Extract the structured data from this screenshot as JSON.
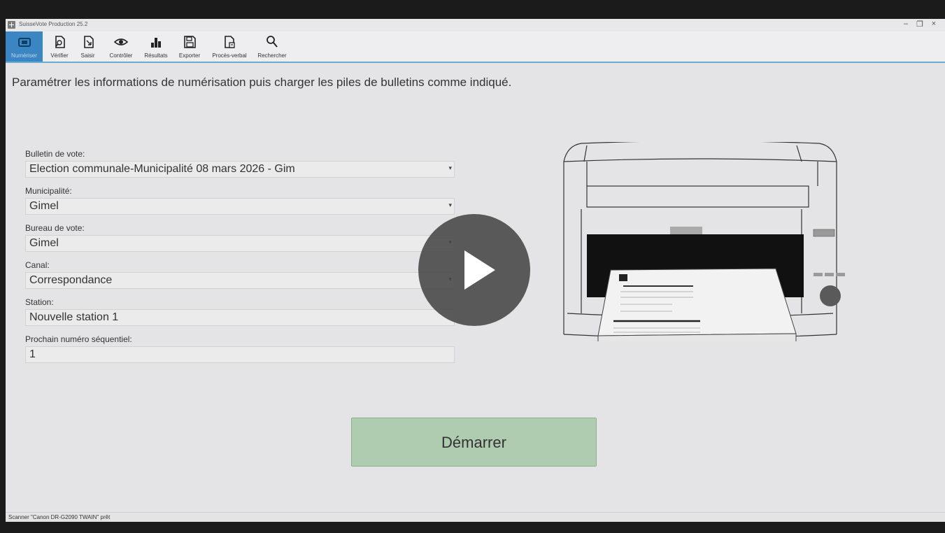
{
  "app": {
    "title": "SuisseVote Production 25.2"
  },
  "toolbar": {
    "items": [
      {
        "label": "Numériser",
        "icon": "scanner-icon",
        "active": true
      },
      {
        "label": "Vérifier",
        "icon": "verify-document-icon"
      },
      {
        "label": "Saisir",
        "icon": "input-document-icon"
      },
      {
        "label": "Contrôler",
        "icon": "eye-icon"
      },
      {
        "label": "Résultats",
        "icon": "bar-chart-icon"
      },
      {
        "label": "Exporter",
        "icon": "floppy-disk-icon"
      },
      {
        "label": "Procès-verbal",
        "icon": "report-document-icon"
      },
      {
        "label": "Rechercher",
        "icon": "search-icon"
      }
    ]
  },
  "main": {
    "instruction": "Paramétrer les informations de numérisation puis charger les piles de bulletins comme indiqué.",
    "fields": {
      "bulletin": {
        "label": "Bulletin de vote:",
        "value": "Election communale-Municipalité 08 mars 2026 - Gim"
      },
      "municipalite": {
        "label": "Municipalité:",
        "value": "Gimel"
      },
      "bureau": {
        "label": "Bureau de vote:",
        "value": "Gimel"
      },
      "canal": {
        "label": "Canal:",
        "value": "Correspondance"
      },
      "station": {
        "label": "Station:",
        "value": "Nouvelle station 1"
      },
      "sequentiel": {
        "label": "Prochain numéro séquentiel:",
        "value": "1"
      }
    },
    "start_button": "Démarrer"
  },
  "status": {
    "text": "Scanner \"Canon DR-G2090 TWAIN\" prêt"
  },
  "colors": {
    "accent": "#3b86c2",
    "start_button": "#afccb0",
    "toolbar_underline": "#6aa9cf"
  }
}
